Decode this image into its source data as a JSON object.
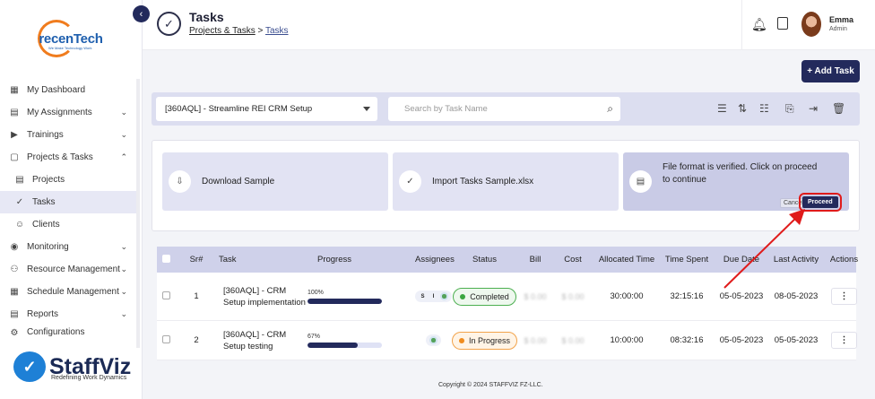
{
  "sidebar": {
    "logo": {
      "text": "recenTech",
      "tagline": "We Make Technology Work"
    },
    "items": [
      {
        "label": "My Dashboard",
        "icon": "dashboard-icon"
      },
      {
        "label": "My Assignments",
        "icon": "assignment-icon"
      },
      {
        "label": "Trainings",
        "icon": "training-icon"
      },
      {
        "label": "Projects & Tasks",
        "icon": "projects-icon"
      },
      {
        "label": "Projects",
        "icon": "project-doc-icon"
      },
      {
        "label": "Tasks",
        "icon": "task-check-icon"
      },
      {
        "label": "Clients",
        "icon": "clients-icon"
      },
      {
        "label": "Monitoring",
        "icon": "monitoring-icon"
      },
      {
        "label": "Resource Management",
        "icon": "resource-icon"
      },
      {
        "label": "Schedule Management",
        "icon": "schedule-icon"
      },
      {
        "label": "Reports",
        "icon": "reports-icon"
      },
      {
        "label": "Configurations",
        "icon": "config-icon"
      }
    ],
    "brand": {
      "name": "StaffViz",
      "tagline": "Redefining Work Dynamics"
    }
  },
  "header": {
    "title": "Tasks",
    "breadcrumb": {
      "parent": "Projects & Tasks",
      "separator": ">",
      "current": "Tasks"
    },
    "user": {
      "name": "Emma",
      "role": "Admin"
    }
  },
  "toolbar": {
    "add_task_label": "+ Add Task"
  },
  "filter": {
    "project_value": "[360AQL] - Streamline REI CRM Setup",
    "search_placeholder": "Search by Task Name"
  },
  "import_panel": {
    "download_label": "Download Sample",
    "import_label": "Import Tasks Sample.xlsx",
    "verify_message": "File format is verified. Click on proceed to continue",
    "cancel_label": "Cancel",
    "proceed_label": "Proceed"
  },
  "table": {
    "headers": [
      "Sr#",
      "Task",
      "Progress",
      "Assignees",
      "Status",
      "Bill",
      "Cost",
      "Allocated Time",
      "Time Spent",
      "Due Date",
      "Last Activity",
      "Actions"
    ],
    "rows": [
      {
        "sr": "1",
        "task": "[360AQL] - CRM Setup implementation",
        "progress_label": "100%",
        "progress": 1.0,
        "assignees": [
          "S",
          "I"
        ],
        "status": "Completed",
        "bill": "$ 0.00",
        "cost": "$ 0.00",
        "allocated": "30:00:00",
        "spent": "32:15:16",
        "due": "05-05-2023",
        "last": "08-05-2023",
        "action": "⋮"
      },
      {
        "sr": "2",
        "task": "[360AQL] - CRM Setup testing",
        "progress_label": "67%",
        "progress": 0.67,
        "assignees": [],
        "status": "In Progress",
        "bill": "$ 0.00",
        "cost": "$ 0.00",
        "allocated": "10:00:00",
        "spent": "08:32:16",
        "due": "05-05-2023",
        "last": "05-05-2023",
        "action": "⋮"
      }
    ]
  },
  "footer": {
    "copyright": "Copyright © 2024 STAFFVIZ FZ-LLC."
  },
  "colors": {
    "primary": "#232a5c",
    "accent_orange": "#f07c1e",
    "completed": "#3aa640",
    "in_progress": "#f08c1e",
    "annotation": "#e01b1b"
  }
}
